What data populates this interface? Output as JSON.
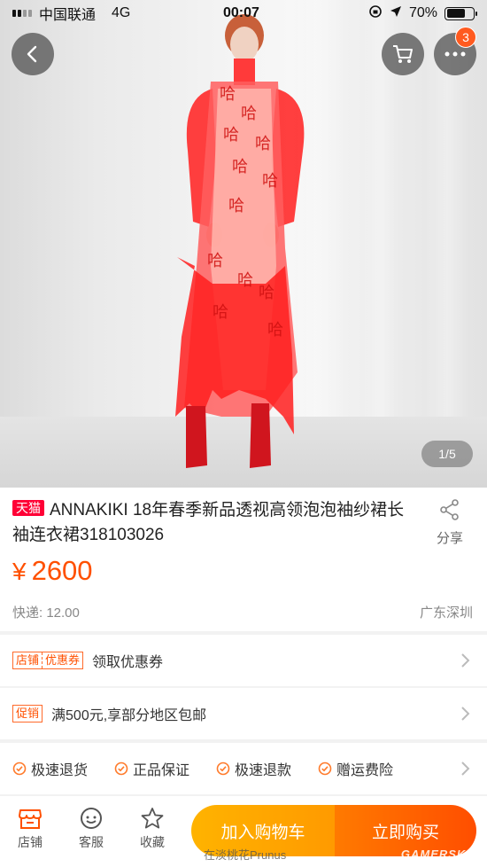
{
  "status_bar": {
    "carrier": "中国联通",
    "network": "4G",
    "time": "00:07",
    "battery": "70%",
    "battery_level": 0.7
  },
  "header": {
    "cart_badge_count": "3",
    "image_counter": "1/5",
    "icons": [
      "back-icon",
      "cart-icon",
      "more-icon"
    ]
  },
  "hero_image": {
    "print_glyph": "哈"
  },
  "product": {
    "store_tag": "天猫",
    "title": "ANNAKIKI 18年春季新品透视高领泡泡袖纱裙长袖连衣裙318103026",
    "share_label": "分享",
    "currency_symbol": "¥",
    "price": "2600",
    "shipping": "快递: 12.00",
    "origin": "广东深圳"
  },
  "coupon_row": {
    "tag_left": "店铺",
    "tag_right": "优惠券",
    "label": "领取优惠券"
  },
  "promo_row": {
    "tag": "促销",
    "label": "满500元,享部分地区包邮"
  },
  "guarantees": [
    "极速退货",
    "正品保证",
    "极速退款",
    "赠运费险"
  ],
  "bottom_bar": {
    "store_label": "店铺",
    "service_label": "客服",
    "favorite_label": "收藏",
    "add_to_cart_label": "加入购物车",
    "buy_now_label": "立即购买"
  },
  "watermark": {
    "text": "在淡桃花Prunus",
    "site": "GAMERSKY"
  },
  "colors": {
    "accent_orange": "#ff5000",
    "tmall_red": "#ff0036",
    "cart_button": "#ffa200",
    "buy_button": "#ff5a00"
  }
}
